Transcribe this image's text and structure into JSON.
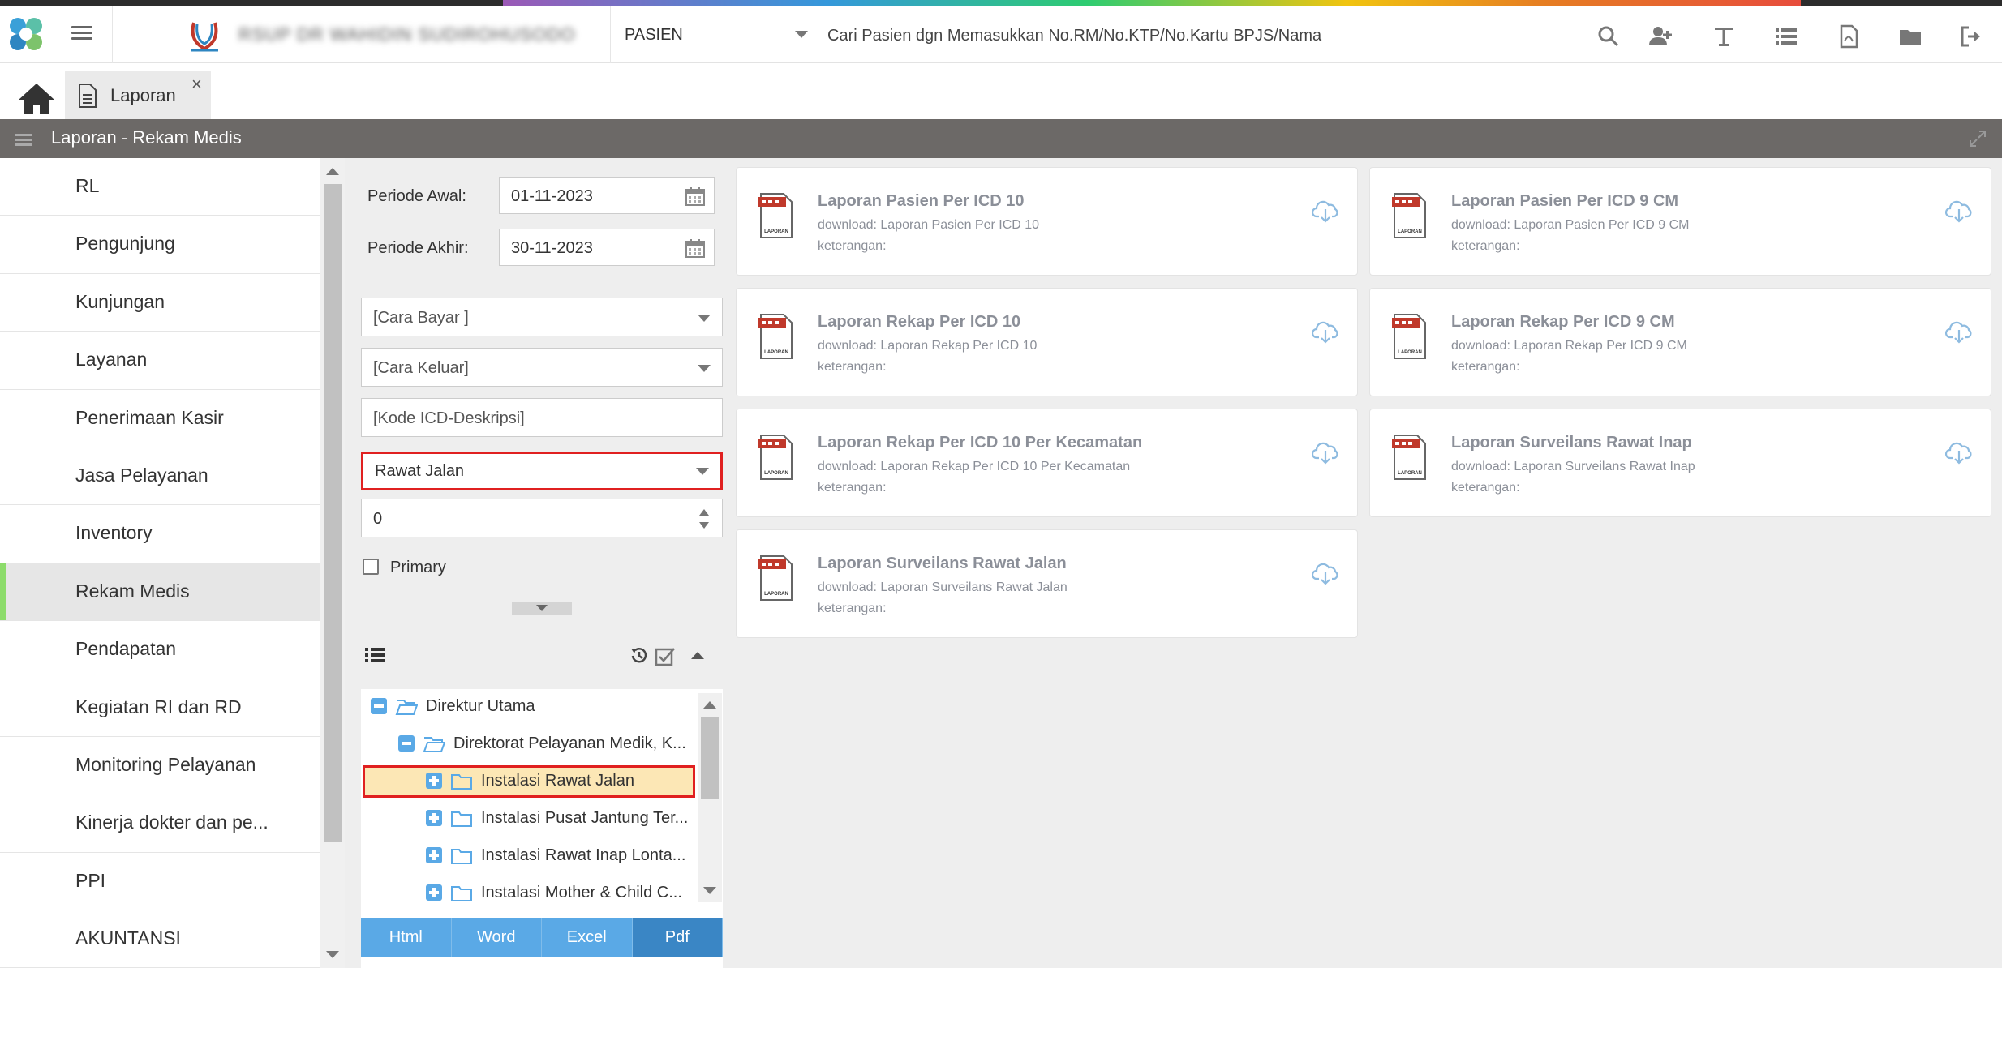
{
  "navbar": {
    "hospital_name": "RSUP DR WAHIDIN SUDIROHUSODO",
    "patient_mode": "PASIEN",
    "search_placeholder": "Cari Pasien dgn Memasukkan No.RM/No.KTP/No.Kartu BPJS/Nama",
    "icons": [
      "search-icon",
      "add-user-icon",
      "text-icon",
      "list-icon",
      "pdf-icon",
      "folder-icon",
      "logout-icon"
    ]
  },
  "tabs": [
    {
      "label": "Laporan",
      "icon": "document-icon",
      "close": "×"
    }
  ],
  "titlebar": {
    "title": "Laporan - Rekam Medis"
  },
  "sidebar": {
    "items": [
      {
        "label": "RL"
      },
      {
        "label": "Pengunjung"
      },
      {
        "label": "Kunjungan"
      },
      {
        "label": "Layanan"
      },
      {
        "label": "Penerimaan Kasir"
      },
      {
        "label": "Jasa Pelayanan"
      },
      {
        "label": "Inventory"
      },
      {
        "label": "Rekam Medis",
        "active": true
      },
      {
        "label": "Pendapatan"
      },
      {
        "label": "Kegiatan RI dan RD"
      },
      {
        "label": "Monitoring Pelayanan"
      },
      {
        "label": "Kinerja dokter dan pe..."
      },
      {
        "label": "PPI"
      },
      {
        "label": "AKUNTANSI"
      }
    ]
  },
  "filters": {
    "periode_awal_label": "Periode Awal:",
    "periode_awal": "01-11-2023",
    "periode_akhir_label": "Periode Akhir:",
    "periode_akhir": "30-11-2023",
    "cara_bayar": "[Cara Bayar ]",
    "cara_keluar": "[Cara Keluar]",
    "kode_icd": "[Kode ICD-Deskripsi]",
    "jenis_layanan": "Rawat Jalan",
    "number_value": "0",
    "primary_label": "Primary",
    "primary_checked": false
  },
  "tree": {
    "nodes": [
      {
        "label": "Direktur Utama",
        "level": 0,
        "expanded": true
      },
      {
        "label": "Direktorat Pelayanan Medik, K...",
        "level": 1,
        "expanded": true
      },
      {
        "label": "Instalasi Rawat Jalan",
        "level": 2,
        "expanded": false,
        "selected": true
      },
      {
        "label": "Instalasi Pusat Jantung Ter...",
        "level": 2,
        "expanded": false
      },
      {
        "label": "Instalasi Rawat Inap Lonta...",
        "level": 2,
        "expanded": false
      },
      {
        "label": "Instalasi Mother & Child C...",
        "level": 2,
        "expanded": false
      }
    ]
  },
  "export": {
    "buttons": [
      "Html",
      "Word",
      "Excel",
      "Pdf"
    ],
    "active": "Pdf"
  },
  "reports": [
    {
      "title": "Laporan Pasien Per ICD 10",
      "download": "download: Laporan Pasien Per ICD 10",
      "keterangan": "keterangan:"
    },
    {
      "title": "Laporan Pasien Per ICD 9 CM",
      "download": "download: Laporan Pasien Per ICD 9 CM",
      "keterangan": "keterangan:"
    },
    {
      "title": "Laporan Rekap Per ICD 10",
      "download": "download: Laporan Rekap Per ICD 10",
      "keterangan": "keterangan:"
    },
    {
      "title": "Laporan Rekap Per ICD 9 CM",
      "download": "download: Laporan Rekap Per ICD 9 CM",
      "keterangan": "keterangan:"
    },
    {
      "title": "Laporan Rekap Per ICD 10 Per Kecamatan",
      "download": "download: Laporan Rekap Per ICD 10 Per Kecamatan",
      "keterangan": "keterangan:"
    },
    {
      "title": "Laporan Surveilans Rawat Inap",
      "download": "download: Laporan Surveilans Rawat Inap",
      "keterangan": "keterangan:"
    },
    {
      "title": "Laporan Surveilans Rawat Jalan",
      "download": "download: Laporan Surveilans Rawat Jalan",
      "keterangan": "keterangan:"
    }
  ],
  "pdf_badge": "LAPORAN",
  "colors": {
    "accent": "#5aa9e6",
    "active_export": "#3a86c5",
    "highlight": "#e02020",
    "active_sidebar": "#8ddc6b",
    "titlebar": "#6c6967"
  }
}
